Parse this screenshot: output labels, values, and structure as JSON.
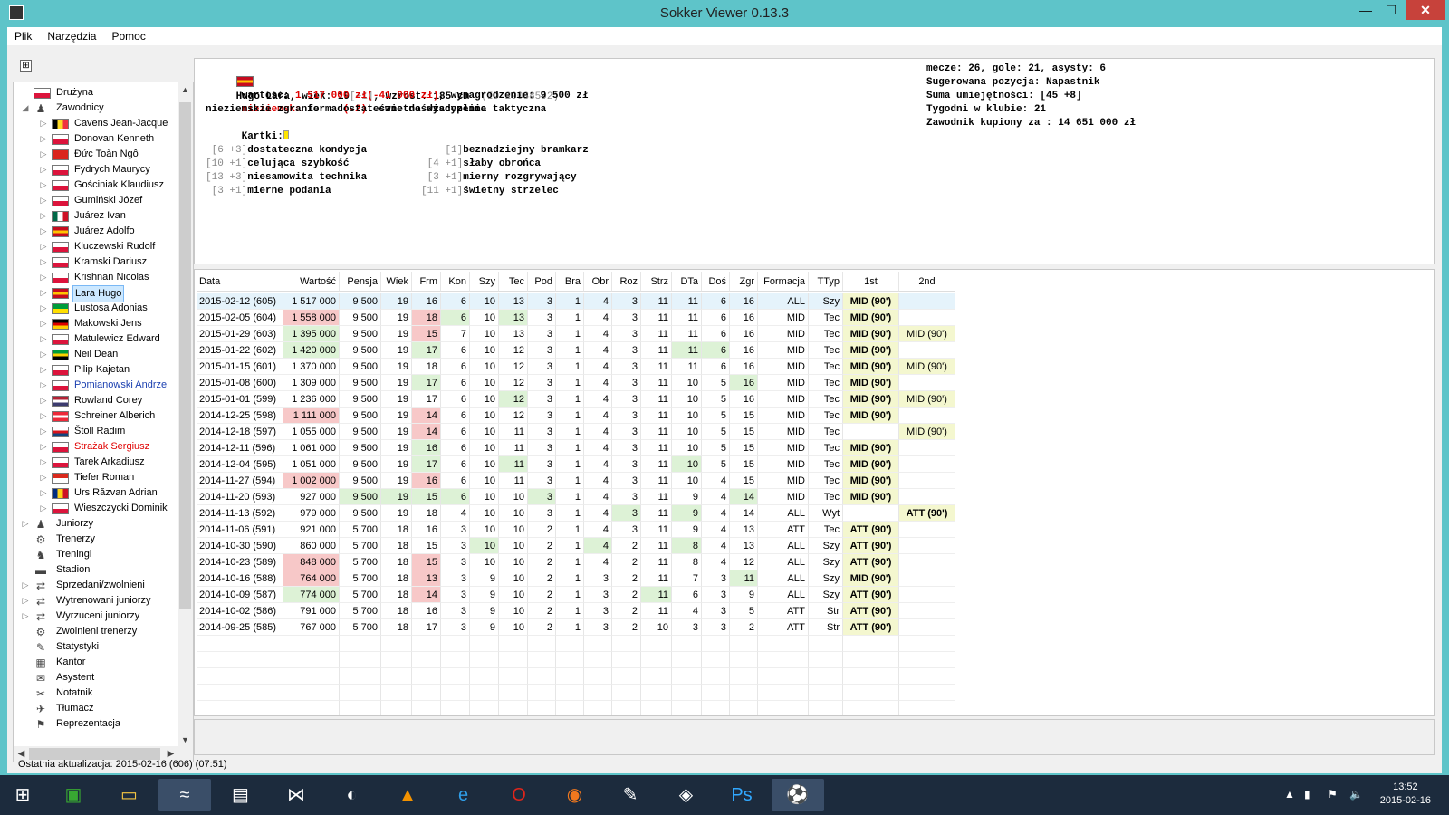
{
  "window": {
    "title": "Sokker Viewer 0.13.3",
    "min_glyph": "—",
    "max_glyph": "☐",
    "close_glyph": "✕"
  },
  "menu": [
    "Plik",
    "Narzędzia",
    "Pomoc"
  ],
  "tree": [
    {
      "label": "Drużyna",
      "level": 0,
      "icon": "flag-icon",
      "flag": [
        "#ffffff",
        "#dc143c"
      ]
    },
    {
      "label": "Zawodnicy",
      "level": 0,
      "expanded": true,
      "icon": "players-icon"
    },
    {
      "label": "Cavens Jean-Jacque",
      "level": 1,
      "flag": [
        "#000000",
        "#fdda24",
        "#ef3340"
      ],
      "flagdir": "v"
    },
    {
      "label": "Donovan Kenneth",
      "level": 1,
      "flag": [
        "#ffffff",
        "#dc143c"
      ]
    },
    {
      "label": "Đức Toàn Ngô",
      "level": 1,
      "flag": [
        "#da251d",
        "#da251d"
      ]
    },
    {
      "label": "Fydrych Maurycy",
      "level": 1,
      "flag": [
        "#ffffff",
        "#dc143c"
      ]
    },
    {
      "label": "Gościniak Klaudiusz",
      "level": 1,
      "flag": [
        "#ffffff",
        "#dc143c"
      ]
    },
    {
      "label": "Gumiński Józef",
      "level": 1,
      "flag": [
        "#ffffff",
        "#dc143c"
      ]
    },
    {
      "label": "Juárez Ivan",
      "level": 1,
      "flag": [
        "#006847",
        "#ffffff",
        "#ce1126"
      ],
      "flagdir": "v"
    },
    {
      "label": "Juárez Adolfo",
      "level": 1,
      "flag": [
        "#c60b1e",
        "#ffc400",
        "#c60b1e"
      ]
    },
    {
      "label": "Kluczewski Rudolf",
      "level": 1,
      "flag": [
        "#ffffff",
        "#dc143c"
      ]
    },
    {
      "label": "Kramski Dariusz",
      "level": 1,
      "flag": [
        "#ffffff",
        "#dc143c"
      ]
    },
    {
      "label": "Krishnan Nicolas",
      "level": 1,
      "flag": [
        "#ffffff",
        "#dc143c"
      ]
    },
    {
      "label": "Lara Hugo",
      "level": 1,
      "selected": true,
      "flag": [
        "#c60b1e",
        "#ffc400",
        "#c60b1e"
      ]
    },
    {
      "label": "Lustosa Adonias",
      "level": 1,
      "flag": [
        "#009c3b",
        "#ffdf00"
      ]
    },
    {
      "label": "Makowski Jens",
      "level": 1,
      "flag": [
        "#000000",
        "#dd0000",
        "#ffce00"
      ]
    },
    {
      "label": "Matulewicz Edward",
      "level": 1,
      "flag": [
        "#ffffff",
        "#dc143c"
      ]
    },
    {
      "label": "Neil Dean",
      "level": 1,
      "flag": [
        "#009b3a",
        "#fed100",
        "#000000"
      ]
    },
    {
      "label": "Pilip Kajetan",
      "level": 1,
      "flag": [
        "#ffffff",
        "#dc143c"
      ]
    },
    {
      "label": "Pomianowski Andrze",
      "level": 1,
      "color": "#1a3fb0",
      "flag": [
        "#ffffff",
        "#dc143c"
      ]
    },
    {
      "label": "Rowland Corey",
      "level": 1,
      "flag": [
        "#b22234",
        "#ffffff",
        "#3c3b6e"
      ]
    },
    {
      "label": "Schreiner Alberich",
      "level": 1,
      "flag": [
        "#ed2939",
        "#ffffff",
        "#ed2939"
      ]
    },
    {
      "label": "Štoll Radim",
      "level": 1,
      "flag": [
        "#ffffff",
        "#d7141a",
        "#11457e"
      ]
    },
    {
      "label": "Strażak Sergiusz",
      "level": 1,
      "color": "#e00000",
      "flag": [
        "#ffffff",
        "#dc143c"
      ]
    },
    {
      "label": "Tarek Arkadiusz",
      "level": 1,
      "flag": [
        "#ffffff",
        "#dc143c"
      ]
    },
    {
      "label": "Tiefer Roman",
      "level": 1,
      "flag": [
        "#da291c",
        "#ffffff"
      ]
    },
    {
      "label": "Urs Răzvan Adrian",
      "level": 1,
      "flag": [
        "#002b7f",
        "#fcd116",
        "#ce1126"
      ],
      "flagdir": "v"
    },
    {
      "label": "Wieszczycki Dominik",
      "level": 1,
      "flag": [
        "#ffffff",
        "#dc143c"
      ]
    },
    {
      "label": "Juniorzy",
      "level": 0,
      "collapsed": true,
      "icon": "juniors-icon"
    },
    {
      "label": "Trenerzy",
      "level": 0,
      "icon": "coaches-icon"
    },
    {
      "label": "Treningi",
      "level": 0,
      "icon": "training-icon"
    },
    {
      "label": "Stadion",
      "level": 0,
      "icon": "stadium-icon"
    },
    {
      "label": "Sprzedani/zwolnieni",
      "level": 0,
      "collapsed": true,
      "icon": "sold-players-icon"
    },
    {
      "label": "Wytrenowani juniorzy",
      "level": 0,
      "collapsed": true,
      "icon": "trained-juniors-icon"
    },
    {
      "label": "Wyrzuceni juniorzy",
      "level": 0,
      "collapsed": true,
      "icon": "fired-juniors-icon"
    },
    {
      "label": "Zwolnieni trenerzy",
      "level": 0,
      "icon": "fired-coaches-icon"
    },
    {
      "label": "Statystyki",
      "level": 0,
      "icon": "statistics-icon"
    },
    {
      "label": "Kantor",
      "level": 0,
      "icon": "exchange-icon"
    },
    {
      "label": "Asystent",
      "level": 0,
      "icon": "assistant-icon"
    },
    {
      "label": "Notatnik",
      "level": 0,
      "icon": "notebook-icon"
    },
    {
      "label": "Tłumacz",
      "level": 0,
      "icon": "translator-icon"
    },
    {
      "label": "Reprezentacja",
      "level": 0,
      "icon": "national-team-icon"
    }
  ],
  "player": {
    "name_line": "Hugo Lara, wiek: 19",
    "age_delta": "[+1]",
    "height": ", wzrost: 185 cm  ",
    "id": "(ID 29088592)",
    "value_label": "wartość: ",
    "value": "1 517 000 zł(-41 000 zł)",
    "salary": ", wynagrodzenie: 9 500 zł",
    "form_word": "nieziemska",
    "form_rest": " forma ",
    "form_delta": "(-2)",
    "discipline": "  świetna dyscyplina taktyczna",
    "line3": "nieziemskie zgranie   dostateczne doświadczenie",
    "cards_label": "Kartki:",
    "skills_left": [
      {
        "br": " [6 +3]",
        "txt": "dostateczna kondycja"
      },
      {
        "br": "[10 +1]",
        "txt": "celująca szybkość"
      },
      {
        "br": "[13 +3]",
        "txt": "niesamowita technika"
      },
      {
        "br": " [3 +1]",
        "txt": "mierne podania"
      }
    ],
    "skills_right": [
      {
        "br": "    [1]",
        "txt": "beznadziejny bramkarz"
      },
      {
        "br": " [4 +1]",
        "txt": "słaby obrońca"
      },
      {
        "br": " [3 +1]",
        "txt": "mierny rozgrywający"
      },
      {
        "br": "[11 +1]",
        "txt": "świetny strzelec"
      }
    ],
    "summary": [
      "mecze: 26, gole: 21, asysty: 6",
      "Sugerowana pozycja: Napastnik",
      "Suma umiejętności: [45 +8]",
      "Tygodni w klubie: 21",
      "Zawodnik kupiony za : 14 651 000 zł"
    ],
    "flag": [
      "#c60b1e",
      "#ffc400",
      "#c60b1e"
    ]
  },
  "table": {
    "columns": [
      "Data",
      "Wartość",
      "Pensja",
      "Wiek",
      "Frm",
      "Kon",
      "Szy",
      "Tec",
      "Pod",
      "Bra",
      "Obr",
      "Roz",
      "Strz",
      "DTa",
      "Doś",
      "Zgr",
      "Formacja",
      "TTyp",
      "1st",
      "2nd"
    ],
    "rows": [
      [
        "2015-02-12 (605)",
        "1 517 000",
        "9 500",
        "19",
        "16",
        "6",
        "10",
        "13",
        "3",
        "1",
        "4",
        "3",
        "11",
        "11",
        "6",
        "16",
        "ALL",
        "Szy",
        "MID (90')",
        ""
      ],
      [
        "2015-02-05 (604)",
        "1 558 000",
        "9 500",
        "19",
        "18",
        "6",
        "10",
        "13",
        "3",
        "1",
        "4",
        "3",
        "11",
        "11",
        "6",
        "16",
        "MID",
        "Tec",
        "MID (90')",
        ""
      ],
      [
        "2015-01-29 (603)",
        "1 395 000",
        "9 500",
        "19",
        "15",
        "7",
        "10",
        "13",
        "3",
        "1",
        "4",
        "3",
        "11",
        "11",
        "6",
        "16",
        "MID",
        "Tec",
        "MID (90')",
        "MID (90')"
      ],
      [
        "2015-01-22 (602)",
        "1 420 000",
        "9 500",
        "19",
        "17",
        "6",
        "10",
        "12",
        "3",
        "1",
        "4",
        "3",
        "11",
        "11",
        "6",
        "16",
        "MID",
        "Tec",
        "MID (90')",
        ""
      ],
      [
        "2015-01-15 (601)",
        "1 370 000",
        "9 500",
        "19",
        "18",
        "6",
        "10",
        "12",
        "3",
        "1",
        "4",
        "3",
        "11",
        "11",
        "6",
        "16",
        "MID",
        "Tec",
        "MID (90')",
        "MID (90')"
      ],
      [
        "2015-01-08 (600)",
        "1 309 000",
        "9 500",
        "19",
        "17",
        "6",
        "10",
        "12",
        "3",
        "1",
        "4",
        "3",
        "11",
        "10",
        "5",
        "16",
        "MID",
        "Tec",
        "MID (90')",
        ""
      ],
      [
        "2015-01-01 (599)",
        "1 236 000",
        "9 500",
        "19",
        "17",
        "6",
        "10",
        "12",
        "3",
        "1",
        "4",
        "3",
        "11",
        "10",
        "5",
        "16",
        "MID",
        "Tec",
        "MID (90')",
        "MID (90')"
      ],
      [
        "2014-12-25 (598)",
        "1 111 000",
        "9 500",
        "19",
        "14",
        "6",
        "10",
        "12",
        "3",
        "1",
        "4",
        "3",
        "11",
        "10",
        "5",
        "15",
        "MID",
        "Tec",
        "MID (90')",
        ""
      ],
      [
        "2014-12-18 (597)",
        "1 055 000",
        "9 500",
        "19",
        "14",
        "6",
        "10",
        "11",
        "3",
        "1",
        "4",
        "3",
        "11",
        "10",
        "5",
        "15",
        "MID",
        "Tec",
        "",
        "MID (90')"
      ],
      [
        "2014-12-11 (596)",
        "1 061 000",
        "9 500",
        "19",
        "16",
        "6",
        "10",
        "11",
        "3",
        "1",
        "4",
        "3",
        "11",
        "10",
        "5",
        "15",
        "MID",
        "Tec",
        "MID (90')",
        ""
      ],
      [
        "2014-12-04 (595)",
        "1 051 000",
        "9 500",
        "19",
        "17",
        "6",
        "10",
        "11",
        "3",
        "1",
        "4",
        "3",
        "11",
        "10",
        "5",
        "15",
        "MID",
        "Tec",
        "MID (90')",
        ""
      ],
      [
        "2014-11-27 (594)",
        "1 002 000",
        "9 500",
        "19",
        "16",
        "6",
        "10",
        "11",
        "3",
        "1",
        "4",
        "3",
        "11",
        "10",
        "4",
        "15",
        "MID",
        "Tec",
        "MID (90')",
        ""
      ],
      [
        "2014-11-20 (593)",
        "927 000",
        "9 500",
        "19",
        "15",
        "6",
        "10",
        "10",
        "3",
        "1",
        "4",
        "3",
        "11",
        "9",
        "4",
        "14",
        "MID",
        "Tec",
        "MID (90')",
        ""
      ],
      [
        "2014-11-13 (592)",
        "979 000",
        "9 500",
        "19",
        "18",
        "4",
        "10",
        "10",
        "3",
        "1",
        "4",
        "3",
        "11",
        "9",
        "4",
        "14",
        "ALL",
        "Wyt",
        "",
        "ATT (90')"
      ],
      [
        "2014-11-06 (591)",
        "921 000",
        "5 700",
        "18",
        "16",
        "3",
        "10",
        "10",
        "2",
        "1",
        "4",
        "3",
        "11",
        "9",
        "4",
        "13",
        "ATT",
        "Tec",
        "ATT (90')",
        ""
      ],
      [
        "2014-10-30 (590)",
        "860 000",
        "5 700",
        "18",
        "15",
        "3",
        "10",
        "10",
        "2",
        "1",
        "4",
        "2",
        "11",
        "8",
        "4",
        "13",
        "ALL",
        "Szy",
        "ATT (90')",
        ""
      ],
      [
        "2014-10-23 (589)",
        "848 000",
        "5 700",
        "18",
        "15",
        "3",
        "10",
        "10",
        "2",
        "1",
        "4",
        "2",
        "11",
        "8",
        "4",
        "12",
        "ALL",
        "Szy",
        "ATT (90')",
        ""
      ],
      [
        "2014-10-16 (588)",
        "764 000",
        "5 700",
        "18",
        "13",
        "3",
        "9",
        "10",
        "2",
        "1",
        "3",
        "2",
        "11",
        "7",
        "3",
        "11",
        "ALL",
        "Szy",
        "MID (90')",
        ""
      ],
      [
        "2014-10-09 (587)",
        "774 000",
        "5 700",
        "18",
        "14",
        "3",
        "9",
        "10",
        "2",
        "1",
        "3",
        "2",
        "11",
        "6",
        "3",
        "9",
        "ALL",
        "Szy",
        "ATT (90')",
        ""
      ],
      [
        "2014-10-02 (586)",
        "791 000",
        "5 700",
        "18",
        "16",
        "3",
        "9",
        "10",
        "2",
        "1",
        "3",
        "2",
        "11",
        "4",
        "3",
        "5",
        "ATT",
        "Str",
        "ATT (90')",
        ""
      ],
      [
        "2014-09-25 (585)",
        "767 000",
        "5 700",
        "18",
        "17",
        "3",
        "9",
        "10",
        "2",
        "1",
        "3",
        "2",
        "10",
        "3",
        "3",
        "2",
        "ATT",
        "Str",
        "ATT (90')",
        ""
      ]
    ],
    "bad_cells": [
      [
        1,
        5
      ],
      [
        2,
        1
      ],
      [
        2,
        4
      ],
      [
        3,
        4
      ],
      [
        8,
        1
      ],
      [
        8,
        4
      ],
      [
        9,
        4
      ],
      [
        12,
        1
      ],
      [
        12,
        4
      ],
      [
        17,
        1
      ],
      [
        17,
        4
      ],
      [
        18,
        1
      ],
      [
        18,
        4
      ],
      [
        19,
        4
      ]
    ],
    "good_cells": [
      [
        1,
        4
      ],
      [
        2,
        5
      ],
      [
        2,
        7
      ],
      [
        3,
        1
      ],
      [
        4,
        1
      ],
      [
        4,
        4
      ],
      [
        4,
        13
      ],
      [
        4,
        14
      ],
      [
        6,
        4
      ],
      [
        6,
        15
      ],
      [
        7,
        7
      ],
      [
        10,
        4
      ],
      [
        11,
        4
      ],
      [
        11,
        7
      ],
      [
        11,
        13
      ],
      [
        13,
        2
      ],
      [
        13,
        3
      ],
      [
        13,
        4
      ],
      [
        13,
        5
      ],
      [
        13,
        8
      ],
      [
        13,
        15
      ],
      [
        14,
        11
      ],
      [
        14,
        13
      ],
      [
        16,
        6
      ],
      [
        16,
        10
      ],
      [
        16,
        13
      ],
      [
        17,
        1
      ],
      [
        18,
        15
      ],
      [
        19,
        1
      ],
      [
        19,
        12
      ]
    ]
  },
  "status": "Ostatnia aktualizacja: 2015-02-16 (606) (07:51)",
  "taskbar": {
    "apps": [
      "windows-start-icon",
      "store-icon",
      "file-explorer-icon",
      "app-icon",
      "box-icon",
      "visual-studio-icon",
      "eclipse-icon",
      "avast-icon",
      "internet-explorer-icon",
      "opera-icon",
      "firefox-icon",
      "gimp-icon",
      "cube-icon",
      "photoshop-icon",
      "sokker-viewer-icon"
    ],
    "time": "13:52",
    "date": "2015-02-16"
  },
  "colors": {
    "title_bg": "#5ec4c9",
    "bad": "#f7c8c8",
    "good": "#ddf2d6",
    "position": "#f4f7cf",
    "red_text": "#e00000"
  }
}
